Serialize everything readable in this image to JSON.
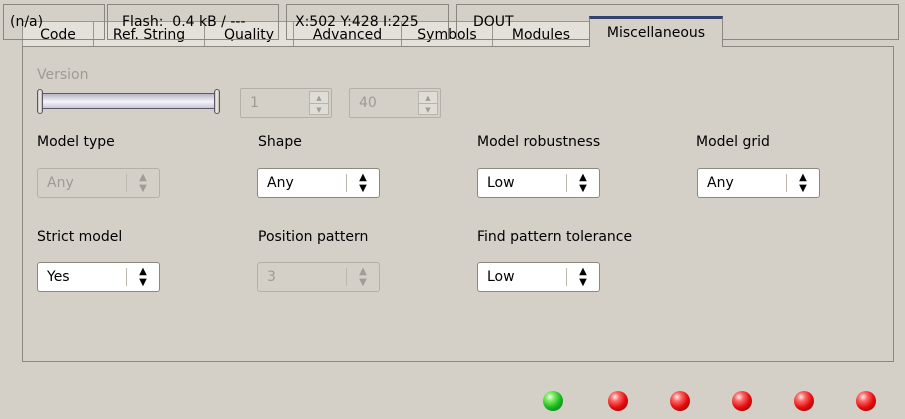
{
  "tabs": [
    {
      "label": "Code"
    },
    {
      "label": "Ref. String"
    },
    {
      "label": "Quality"
    },
    {
      "label": "Advanced"
    },
    {
      "label": "Symbols"
    },
    {
      "label": "Modules"
    },
    {
      "label": "Miscellaneous",
      "active": true
    }
  ],
  "version": {
    "label": "Version",
    "min_value": "1",
    "max_value": "40"
  },
  "fields": {
    "model_type": {
      "label": "Model type",
      "value": "Any"
    },
    "shape": {
      "label": "Shape",
      "value": "Any"
    },
    "model_robustness": {
      "label": "Model robustness",
      "value": "Low"
    },
    "model_grid": {
      "label": "Model grid",
      "value": "Any"
    },
    "strict_model": {
      "label": "Strict model",
      "value": "Yes"
    },
    "position_pattern": {
      "label": "Position pattern",
      "value": "3"
    },
    "find_pattern_tolerance": {
      "label": "Find pattern tolerance",
      "value": "Low"
    }
  },
  "status": {
    "na": "(n/a)",
    "flash": "Flash:  0.4 kB / ---",
    "coords": "X:502 Y:428 I:225",
    "dout": "DOUT",
    "leds": [
      "green",
      "red",
      "red",
      "red",
      "red",
      "red"
    ]
  },
  "icons": {
    "spin_up": "spin-up-icon",
    "spin_down": "spin-down-icon",
    "combo": "updown-arrow-icon"
  },
  "colors": {
    "active_tab_accent": "#33416e",
    "led_green": "#16b820",
    "led_red": "#e40e0e",
    "background": "#d4d0c8"
  }
}
